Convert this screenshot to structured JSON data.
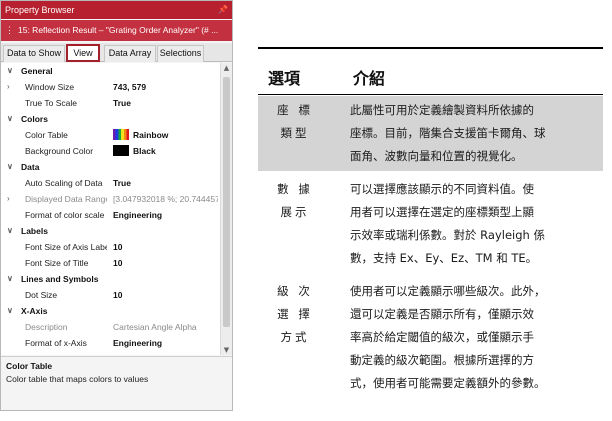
{
  "panel": {
    "title": "Property Browser",
    "subtitle": "15: Reflection Result – \"Grating Order Analyzer\" (# ...",
    "tabs": [
      "Data to Show",
      "View",
      "Data Array",
      "Selections"
    ],
    "active_tab": "View",
    "properties": [
      {
        "type": "category",
        "label": "General"
      },
      {
        "type": "item",
        "label": "Window Size",
        "value": "743, 579",
        "expandable": true
      },
      {
        "type": "item",
        "label": "True To Scale",
        "value": "True"
      },
      {
        "type": "category",
        "label": "Colors"
      },
      {
        "type": "item",
        "label": "Color Table",
        "value": "Rainbow",
        "swatch": "rainbow"
      },
      {
        "type": "item",
        "label": "Background Color",
        "value": "Black",
        "swatch": "black"
      },
      {
        "type": "category",
        "label": "Data"
      },
      {
        "type": "item",
        "label": "Auto Scaling of Data",
        "value": "True"
      },
      {
        "type": "item",
        "label": "Displayed Data Range",
        "value": "[3.047932018 %; 20.744457",
        "expandable": true,
        "disabled": true
      },
      {
        "type": "item",
        "label": "Format of color scale",
        "value": "Engineering"
      },
      {
        "type": "category",
        "label": "Labels"
      },
      {
        "type": "item",
        "label": "Font Size of Axis Labels",
        "value": "10"
      },
      {
        "type": "item",
        "label": "Font Size of Title",
        "value": "10"
      },
      {
        "type": "category",
        "label": "Lines and Symbols"
      },
      {
        "type": "item",
        "label": "Dot Size",
        "value": "10"
      },
      {
        "type": "category",
        "label": "X-Axis"
      },
      {
        "type": "item",
        "label": "Description",
        "value": "Cartesian Angle Alpha",
        "disabled": true
      },
      {
        "type": "item",
        "label": "Format of x-Axis",
        "value": "Engineering"
      }
    ],
    "description": {
      "title": "Color Table",
      "text": "Color table that maps colors to values"
    },
    "colors": {
      "title_bar": "#b7202e",
      "subtitle_bar": "#c3303f",
      "active_tab_border": "#a31f2b"
    }
  },
  "table": {
    "headers": [
      "選項",
      "介紹"
    ],
    "rows": [
      {
        "term": [
          "座 標",
          "類型"
        ],
        "intro": [
          "此屬性可用於定義繪製資料所依據的",
          "座標。目前，階集合支援笛卡爾角、球",
          "面角、波數向量和位置的視覺化。"
        ],
        "shaded": true
      },
      {
        "term": [
          "數 據",
          "展示"
        ],
        "intro": [
          "可以選擇應該顯示的不同資料值。使",
          "用者可以選擇在選定的座標類型上顯",
          "示效率或瑞利係數。對於 Rayleigh 係",
          "數，支持 Ex、Ey、Ez、TM 和 TE。"
        ],
        "shaded": false
      },
      {
        "term": [
          "級 次",
          "選 擇",
          "方式"
        ],
        "intro": [
          "使用者可以定義顯示哪些級次。此外，",
          "還可以定義是否顯示所有，僅顯示效",
          "率高於給定閾值的級次，或僅顯示手",
          "動定義的級次範圍。根據所選擇的方",
          "式，使用者可能需要定義額外的參數。"
        ],
        "shaded": false
      }
    ],
    "colors": {
      "shade": "#d4d4d4"
    }
  }
}
